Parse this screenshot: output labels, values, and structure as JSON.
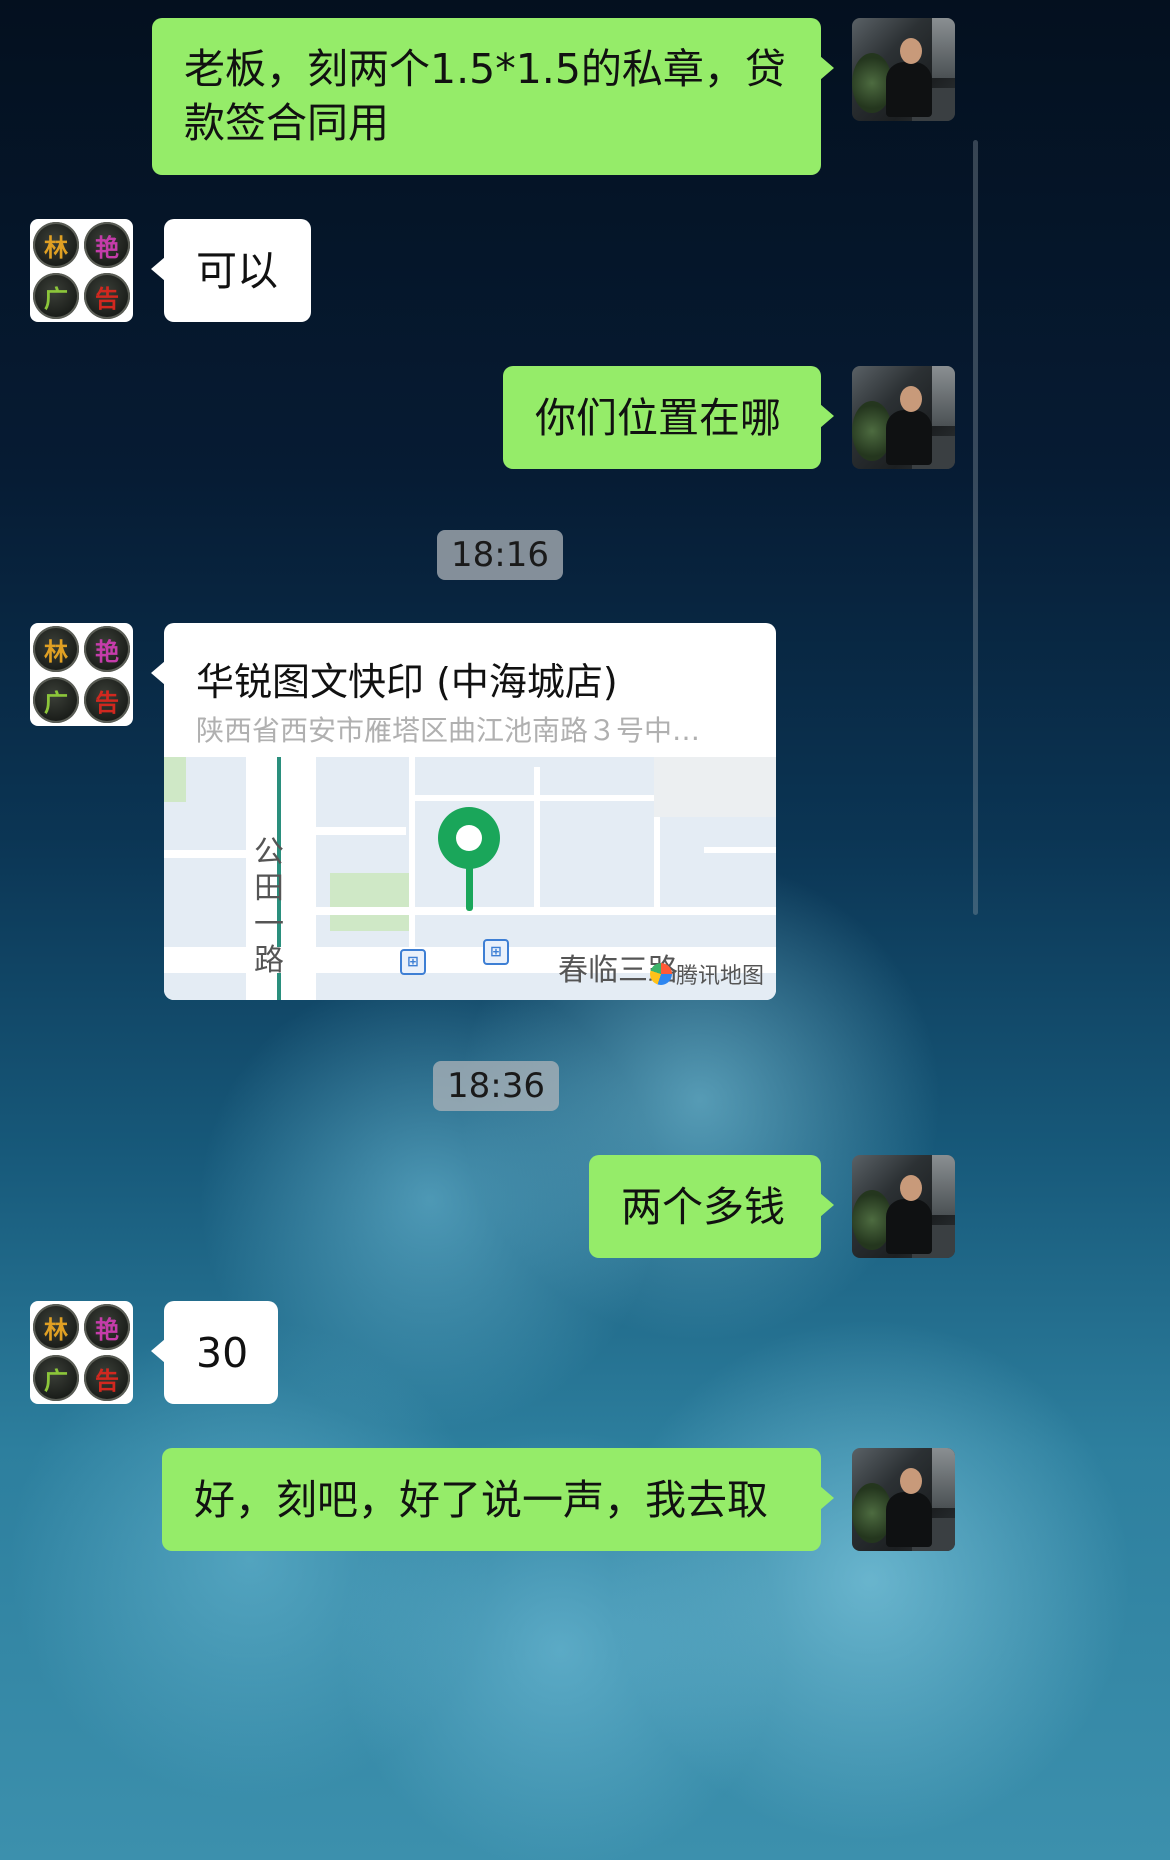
{
  "messages": {
    "m1": "老板，刻两个1.5*1.5的私章，贷款签合同用",
    "m2": "可以",
    "m3": "你们位置在哪",
    "m4": "两个多钱",
    "m5": "30",
    "m6": "好，刻吧，好了说一声，我去取"
  },
  "timestamps": {
    "t1": "18:16",
    "t2": "18:36"
  },
  "location_card": {
    "title": "华锐图文快印 (中海城店)",
    "address": "陕西省西安市雁塔区曲江池南路３号中…",
    "map_road_vertical": "公田一路",
    "map_road_horizontal": "春临三路",
    "map_brand": "腾讯地图",
    "pin_color": "#1aa65a"
  },
  "avatars": {
    "shop_chars": [
      "林",
      "艳",
      "广",
      "告"
    ]
  },
  "colors": {
    "sent_bubble": "#95ec69",
    "received_bubble": "#ffffff"
  }
}
